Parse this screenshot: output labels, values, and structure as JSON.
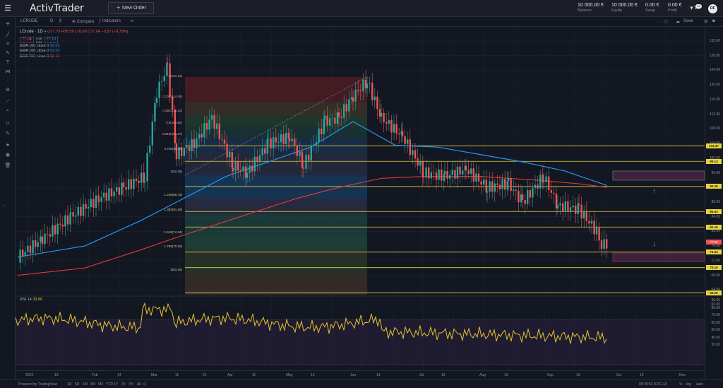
{
  "app": {
    "logo": "ActivTrader",
    "new_order_label": "New Order"
  },
  "account": [
    {
      "value": "10 000.00 €",
      "label": "Balance"
    },
    {
      "value": "10 000.00 €",
      "label": "Equity"
    },
    {
      "value": "0.00 €",
      "label": "Swap"
    },
    {
      "value": "0.00 €",
      "label": "Profit"
    }
  ],
  "notifications_badge": "16",
  "avatar": "DF",
  "chart_toolbar": {
    "symbol": "LCRUDE",
    "timeframe": "D",
    "compare": "Compare",
    "indicators": "Indicators",
    "save": "Save"
  },
  "legend": {
    "symbol": "LCrude · 1D",
    "ohlc": "O77.79 H78.39 L76.60 C77.04 −0.57 (−0.73%)",
    "bid": "77.04",
    "spread_top": "0.06",
    "spread_bot": "0.01",
    "ask": "77.10",
    "emas": [
      {
        "label": "EMA 100 close 0",
        "value": "93.03",
        "color": "#2196f3"
      },
      {
        "label": "EMA 100 close 0",
        "value": "93.03",
        "color": "#2196f3"
      },
      {
        "label": "EMA 200 close 0",
        "value": "90.34",
        "color": "#ef5350"
      }
    ]
  },
  "price_axis": {
    "ticks": [
      "132.00",
      "128.00",
      "124.00",
      "120.00",
      "116.00",
      "112.00",
      "108.00",
      "104.00",
      "100.00",
      "96.00",
      "92.00",
      "88.00",
      "84.00",
      "80.00",
      "76.00",
      "72.00",
      "68.00",
      "64.00",
      "60.00"
    ],
    "highlights": [
      "103.37",
      "99.13",
      "92.28",
      "85.43",
      "81.19",
      "74.34",
      "70.10",
      "63.25"
    ],
    "current": "77.04"
  },
  "rsi": {
    "label": "RSI 14",
    "value": "33.86",
    "ticks": [
      "90.00",
      "80.00",
      "70.00",
      "60.00",
      "50.00",
      "40.00",
      "30.00"
    ]
  },
  "fib_labels": [
    "0(121.31)",
    "0.236(114.48)",
    "0.382(110.22)",
    "0.5(106.80)",
    "0.618(103.37)",
    "0.786(99.13)",
    "1(92.28)",
    "1.236(85.43)",
    "1.382(81.19)",
    "1.618(74.34)",
    "1.786(70.10)",
    "2(63.25)"
  ],
  "time_axis": [
    "2022",
    "13",
    "Feb",
    "14",
    "Mar",
    "11",
    "21",
    "Apr",
    "11",
    "May",
    "13",
    "Jun",
    "13",
    "Jul",
    "13",
    "Aug",
    "13",
    "Sep",
    "13",
    "Oct",
    "12",
    "Nov"
  ],
  "bottom": {
    "powered": "Powered by TradingView",
    "ranges": [
      "1D",
      "5D",
      "1M",
      "3M",
      "6M",
      "YTD",
      "1Y",
      "3Y",
      "5Y",
      "All"
    ],
    "clock": "08:35:52 (UTC+2)",
    "modes": [
      "%",
      "log",
      "auto"
    ]
  },
  "colors": {
    "ema_fast": "#2196f3",
    "ema_slow": "#e53935",
    "fib_line": "#e6d33d",
    "rsi": "#e6c430"
  }
}
